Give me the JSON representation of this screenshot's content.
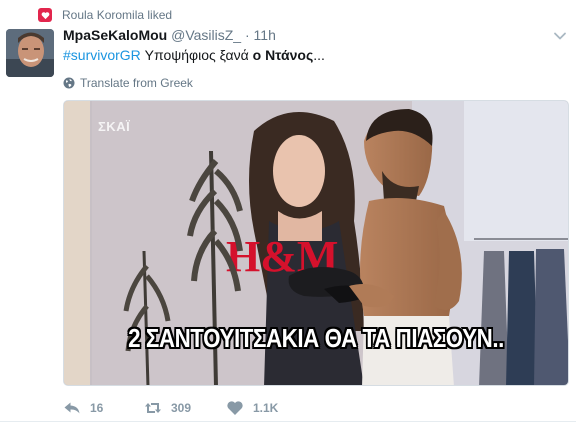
{
  "liked": {
    "text": "Roula Koromila liked"
  },
  "tweet": {
    "display_name": "MpaSeKaloMou",
    "handle": "@VasilisZ_",
    "separator": "·",
    "time": "11h",
    "hashtag": "#survivorGR",
    "text_plain": " Υποψήφιος ξανά ",
    "text_bold": "ο Ντάνος",
    "text_end": "...",
    "translate_label": "Translate from Greek"
  },
  "media": {
    "channel_logo": "ΣΚΑΪ",
    "caption": "2 ΣΑΝΤΟΥΙΤΣΑΚΙΑ ΘΑ ΤΑ ΠΙΑΣΟΥΝ..",
    "banner_brand": "H&M"
  },
  "actions": {
    "reply_count": "16",
    "retweet_count": "309",
    "like_count": "1.1K"
  },
  "colors": {
    "like_badge": "#e2264d",
    "link": "#1b95e0",
    "meta": "#657786",
    "action": "#8899a6"
  }
}
